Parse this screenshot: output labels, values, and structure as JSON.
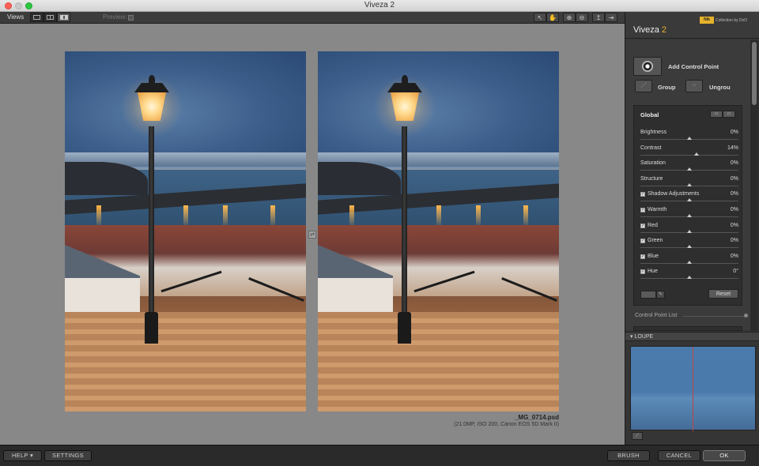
{
  "window": {
    "title": "Viveza 2"
  },
  "toolbar": {
    "views_label": "Views",
    "preview_label": "Preview:",
    "view_buttons": [
      "single-view",
      "split-view",
      "dual-view"
    ],
    "tool_icons": [
      "hand-icon",
      "move-icon",
      "zoom-in-icon",
      "zoom-out-icon",
      "pin-icon",
      "export-icon"
    ]
  },
  "canvas": {
    "file_name": "_MG_0714.psd",
    "file_info": "(21.0MP, ISO 200, Canon EOS 5D Mark II)"
  },
  "panel": {
    "brand_badge": "Nik",
    "brand_text": "Collection by DxO",
    "product": "Viveza",
    "version": "2",
    "add_control_point": "Add Control Point",
    "group": "Group",
    "ungroup": "Ungrou",
    "global_title": "Global",
    "sliders": [
      {
        "label": "Brightness",
        "value": "0%",
        "checkbox": false,
        "position": 0.5
      },
      {
        "label": "Contrast",
        "value": "14%",
        "checkbox": false,
        "position": 0.57
      },
      {
        "label": "Saturation",
        "value": "0%",
        "checkbox": false,
        "position": 0.5
      },
      {
        "label": "Structure",
        "value": "0%",
        "checkbox": false,
        "position": 0.5
      },
      {
        "label": "Shadow Adjustments",
        "value": "0%",
        "checkbox": true,
        "position": 0.5
      },
      {
        "label": "Warmth",
        "value": "0%",
        "checkbox": true,
        "position": 0.5
      },
      {
        "label": "Red",
        "value": "0%",
        "checkbox": true,
        "position": 0.5
      },
      {
        "label": "Green",
        "value": "0%",
        "checkbox": true,
        "position": 0.5
      },
      {
        "label": "Blue",
        "value": "0%",
        "checkbox": true,
        "position": 0.5
      },
      {
        "label": "Hue",
        "value": "0°",
        "checkbox": true,
        "position": 0.5
      }
    ],
    "reset": "Reset",
    "control_point_list": "Control Point List",
    "loupe": "▾ LOUPE"
  },
  "bottom": {
    "help": "HELP ▾",
    "settings": "SETTINGS",
    "brush": "BRUSH",
    "cancel": "CANCEL",
    "ok": "OK"
  },
  "colors": {
    "accent": "#e6b22c",
    "canvas_bg": "#888888",
    "panel_bg": "#353535"
  }
}
